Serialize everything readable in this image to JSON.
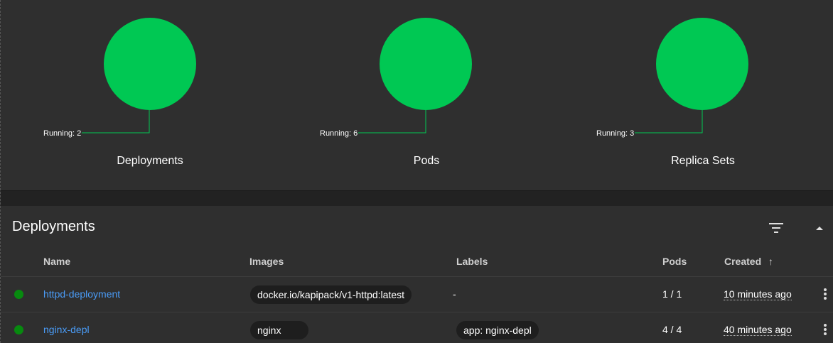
{
  "workloads": [
    {
      "title": "Deployments",
      "status_label": "Running: 2",
      "running": 2,
      "color": "#00c853"
    },
    {
      "title": "Pods",
      "status_label": "Running: 6",
      "running": 6,
      "color": "#00c853"
    },
    {
      "title": "Replica Sets",
      "status_label": "Running: 3",
      "running": 3,
      "color": "#00c853"
    }
  ],
  "deployments": {
    "title": "Deployments",
    "icons": {
      "filter": "filter-icon",
      "collapse": "arrow-up-icon",
      "menu": "more-vert-icon"
    },
    "columns": {
      "name": "Name",
      "images": "Images",
      "labels": "Labels",
      "pods": "Pods",
      "created": "Created",
      "created_sort_icon": "↑"
    },
    "rows": [
      {
        "status_color": "#078a0f",
        "name": "httpd-deployment",
        "image": "docker.io/kapipack/v1-httpd:latest",
        "labels": "-",
        "pods": "1 / 1",
        "created": "10 minutes ago"
      },
      {
        "status_color": "#078a0f",
        "name": "nginx-depl",
        "image": "nginx",
        "labels": "app: nginx-depl",
        "pods": "4 / 4",
        "created": "40 minutes ago"
      }
    ]
  }
}
